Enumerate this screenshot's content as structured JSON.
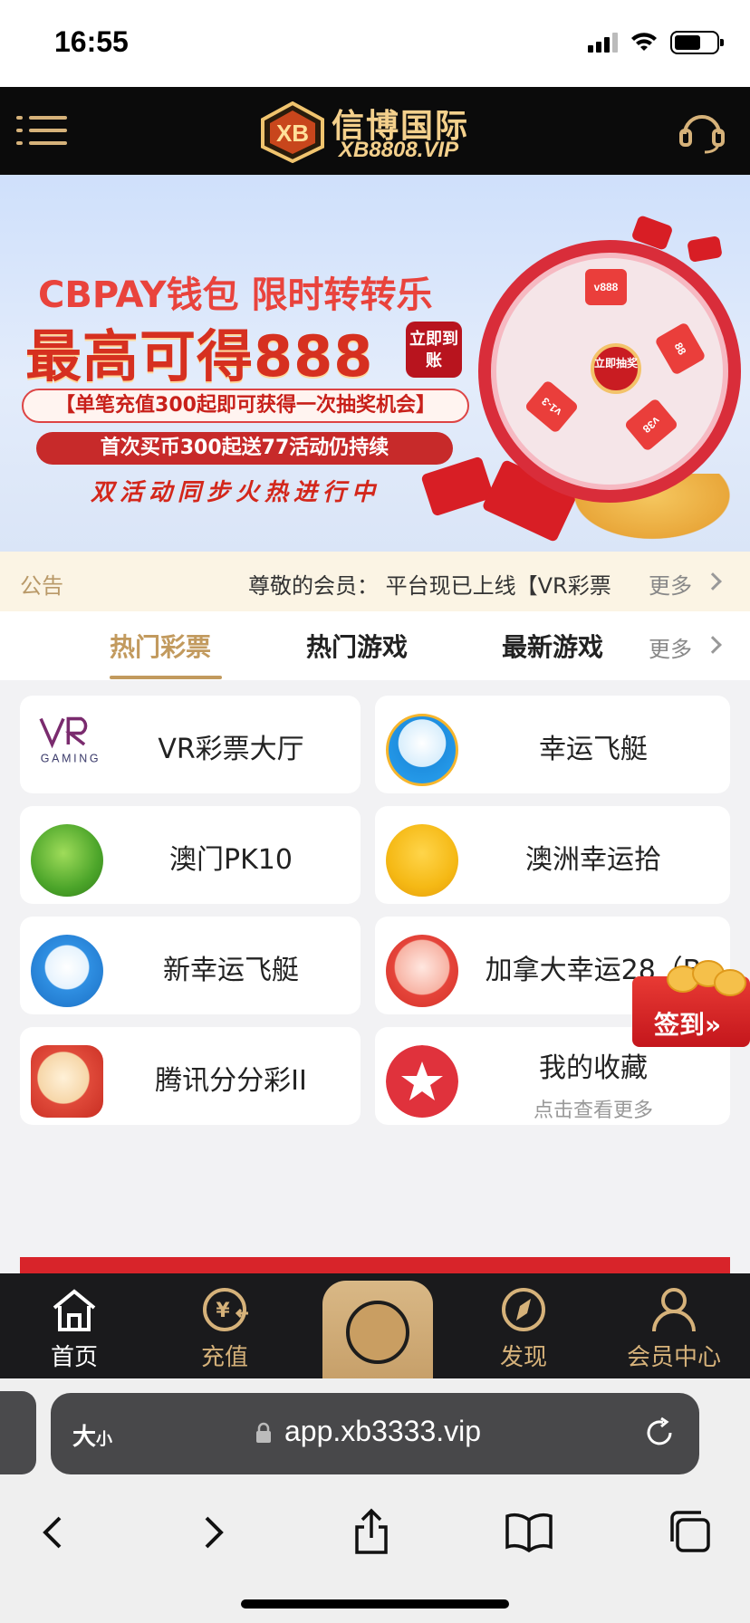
{
  "status_bar": {
    "time": "16:55"
  },
  "header": {
    "logo_cn": "信博国际",
    "logo_en": "XB8808.VIP",
    "logo_mark": "XB"
  },
  "banner": {
    "line1": "CBPAY钱包 限时转转乐",
    "line2": "最高可得888",
    "pill": "立即到账",
    "line3": "【单笔充值300起即可获得一次抽奖机会】",
    "line4": "首次买币300起送77活动仍持续",
    "line5": "双活动同步火热进行中",
    "wheel_center": "立即抽奖",
    "wheel_prizes": [
      "v888",
      "88",
      "v38",
      "v1-3"
    ]
  },
  "notice": {
    "label": "公告",
    "text": "尊敬的会员： 平台现已上线【VR彩票",
    "more": "更多"
  },
  "tabs": {
    "items": [
      "热门彩票",
      "热门游戏",
      "最新游戏"
    ],
    "active_index": 0,
    "more": "更多"
  },
  "games": [
    {
      "name": "VR彩票大厅",
      "icon": "vr-gaming-logo"
    },
    {
      "name": "幸运飞艇",
      "icon": "lucky-boat-icon"
    },
    {
      "name": "澳门PK10",
      "icon": "macau-pk10-icon"
    },
    {
      "name": "澳洲幸运拾",
      "icon": "australia-lucky10-icon"
    },
    {
      "name": "新幸运飞艇",
      "icon": "new-lucky-boat-icon"
    },
    {
      "name": "加拿大幸运28（B",
      "icon": "canada-lucky28-icon"
    },
    {
      "name": "腾讯分分彩II",
      "icon": "tencent-ffc-icon"
    },
    {
      "name": "我的收藏",
      "sub": "点击查看更多",
      "icon": "star-icon"
    }
  ],
  "checkin": {
    "label": "签到»"
  },
  "bottom_nav": [
    {
      "label": "首页",
      "icon": "home-icon",
      "active": true
    },
    {
      "label": "充值",
      "icon": "recharge-icon",
      "active": false
    },
    {
      "label": "",
      "icon": "center-icon",
      "active": false
    },
    {
      "label": "发现",
      "icon": "compass-icon",
      "active": false
    },
    {
      "label": "会员中心",
      "icon": "user-icon",
      "active": false
    }
  ],
  "browser": {
    "text_size": "大",
    "text_size_small": "小",
    "url": "app.xb3333.vip"
  },
  "colors": {
    "gold": "#c29a5e",
    "header_bg": "#0b0b0b",
    "nav_bg": "#1a1a1c",
    "notice_bg": "#fbf4e4"
  }
}
